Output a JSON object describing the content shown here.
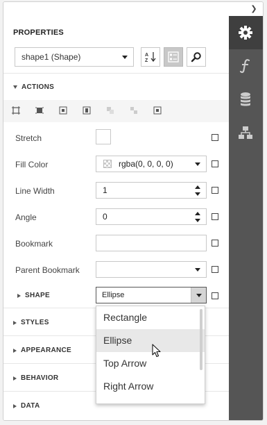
{
  "panel": {
    "title": "PROPERTIES",
    "object_selector": "shape1 (Shape)",
    "toolbar": {
      "sort_icon": "sort-alphabetical-icon",
      "categories_icon": "categorized-view-icon",
      "search_icon": "search-icon"
    }
  },
  "sidebar_tabs": [
    {
      "icon": "gear-icon",
      "active": true
    },
    {
      "icon": "function-icon",
      "active": false
    },
    {
      "icon": "database-icon",
      "active": false
    },
    {
      "icon": "report-explorer-icon",
      "active": false
    }
  ],
  "sections": {
    "actions": "ACTIONS",
    "shape": "SHAPE",
    "styles": "STYLES",
    "appearance": "APPEARANCE",
    "behavior": "BEHAVIOR",
    "data": "DATA"
  },
  "properties": {
    "stretch": {
      "label": "Stretch"
    },
    "fill_color": {
      "label": "Fill Color",
      "value": "rgba(0, 0, 0, 0)"
    },
    "line_width": {
      "label": "Line Width",
      "value": "1"
    },
    "angle": {
      "label": "Angle",
      "value": "0"
    },
    "bookmark": {
      "label": "Bookmark",
      "value": ""
    },
    "parent_bookmark": {
      "label": "Parent Bookmark",
      "value": ""
    },
    "shape": {
      "value": "Ellipse"
    }
  },
  "shape_dropdown": {
    "options": [
      "Rectangle",
      "Ellipse",
      "Top Arrow",
      "Right Arrow"
    ],
    "hovered": "Ellipse"
  },
  "colors": {
    "sidebar": "#555555",
    "sidebar_active": "#3f3f3f",
    "hover": "#e8e8e8"
  }
}
